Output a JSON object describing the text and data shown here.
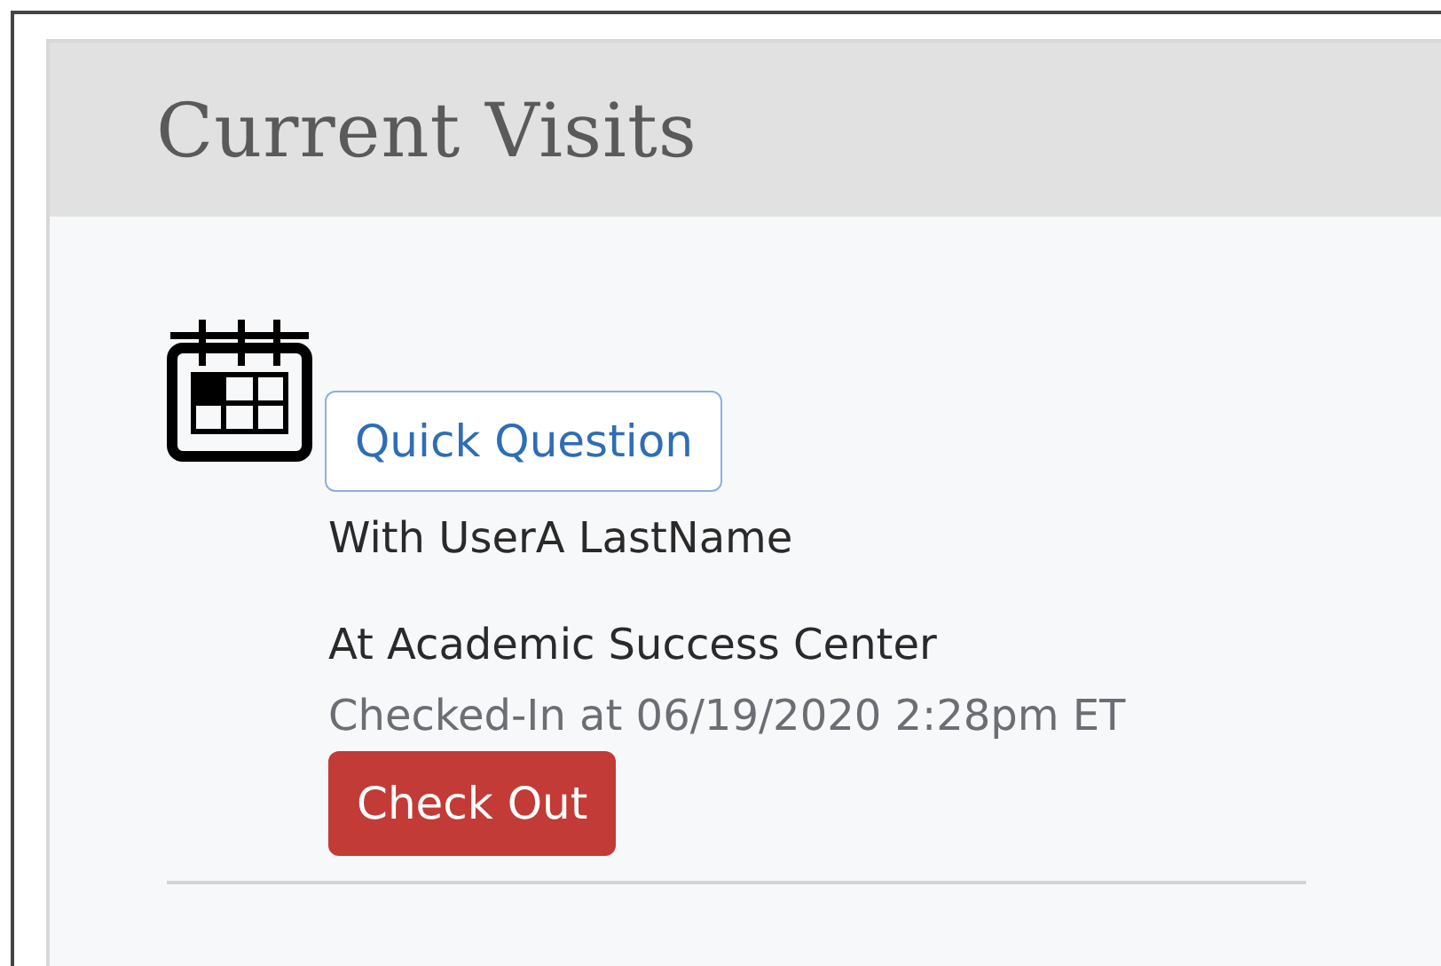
{
  "panel": {
    "title": "Current Visits"
  },
  "visits": [
    {
      "type_button": "Quick Question",
      "with": "With UserA LastName",
      "at": "At Academic Success Center",
      "checked_in": "Checked-In at 06/19/2020 2:28pm ET",
      "action": "Check Out"
    }
  ]
}
